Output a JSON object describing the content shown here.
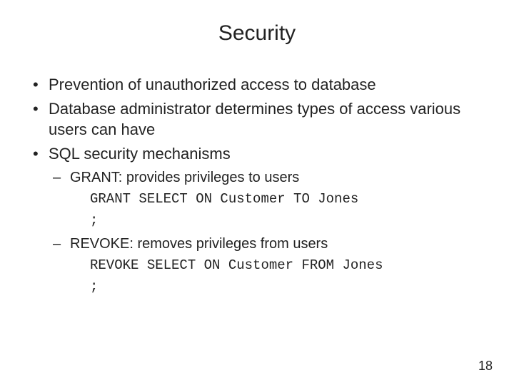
{
  "title": "Security",
  "bullets": [
    "Prevention of unauthorized access to database",
    "Database administrator determines types of access various users can have",
    "SQL security mechanisms"
  ],
  "sub": {
    "grant": {
      "label": "GRANT: provides privileges to users",
      "code1": "GRANT SELECT ON Customer TO Jones",
      "code2": ";"
    },
    "revoke": {
      "label": "REVOKE: removes privileges from users",
      "code1": "REVOKE SELECT ON Customer FROM Jones",
      "code2": ";"
    }
  },
  "page_number": "18"
}
